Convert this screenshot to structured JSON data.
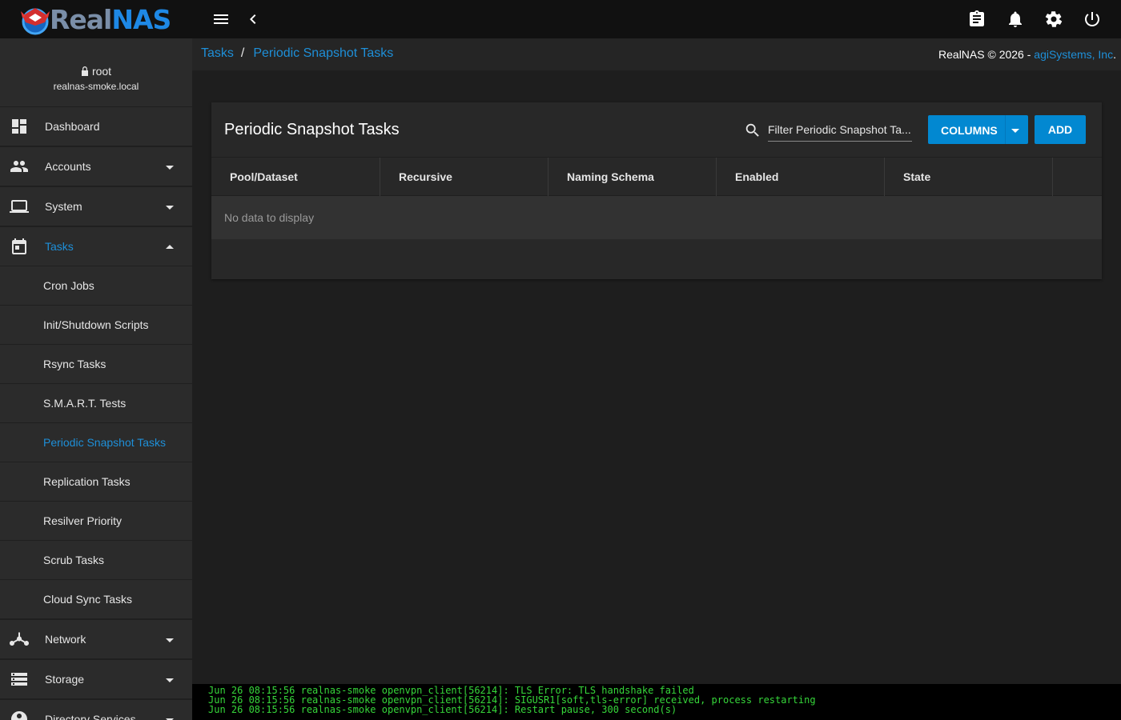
{
  "app": {
    "logo_real": "Real",
    "logo_nas": "NAS"
  },
  "topbar": {
    "icons": [
      "menu-icon",
      "chevron-left-icon",
      "clipboard-icon",
      "bell-icon",
      "gear-icon",
      "power-icon"
    ]
  },
  "user": {
    "name": "root",
    "host": "realnas-smoke.local"
  },
  "sidebar": {
    "items": [
      {
        "label": "Dashboard",
        "icon": "dashboard-icon",
        "expandable": false
      },
      {
        "label": "Accounts",
        "icon": "people-icon",
        "expandable": true,
        "expanded": false
      },
      {
        "label": "System",
        "icon": "laptop-icon",
        "expandable": true,
        "expanded": false
      },
      {
        "label": "Tasks",
        "icon": "calendar-icon",
        "expandable": true,
        "expanded": true,
        "active": true
      },
      {
        "label": "Network",
        "icon": "network-icon",
        "expandable": true,
        "expanded": false
      },
      {
        "label": "Storage",
        "icon": "storage-icon",
        "expandable": true,
        "expanded": false
      },
      {
        "label": "Directory Services",
        "icon": "directory-icon",
        "expandable": true,
        "expanded": false
      }
    ],
    "task_subitems": [
      "Cron Jobs",
      "Init/Shutdown Scripts",
      "Rsync Tasks",
      "S.M.A.R.T. Tests",
      "Periodic Snapshot Tasks",
      "Replication Tasks",
      "Resilver Priority",
      "Scrub Tasks",
      "Cloud Sync Tasks"
    ],
    "active_subitem": "Periodic Snapshot Tasks"
  },
  "breadcrumb": {
    "parent": "Tasks",
    "separator": "/",
    "current": "Periodic Snapshot Tasks"
  },
  "copyright": {
    "text": "RealNAS © 2026 - ",
    "company": "agiSystems, Inc",
    "suffix": "."
  },
  "card": {
    "title": "Periodic Snapshot Tasks",
    "filter_placeholder": "Filter Periodic Snapshot Ta...",
    "columns_button": "COLUMNS",
    "add_button": "ADD",
    "columns": [
      "Pool/Dataset",
      "Recursive",
      "Naming Schema",
      "Enabled",
      "State"
    ],
    "empty_message": "No data to display"
  },
  "console": {
    "lines": [
      "Jun 26 08:15:56 realnas-smoke openvpn_client[56214]: TLS Error: TLS handshake failed",
      "Jun 26 08:15:56 realnas-smoke openvpn_client[56214]: SIGUSR1[soft,tls-error] received, process restarting",
      "Jun 26 08:15:56 realnas-smoke openvpn_client[56214]: Restart pause, 300 second(s)"
    ]
  },
  "colors": {
    "accent": "#1e8fd8",
    "button": "#0288d1",
    "console_text": "#36d63a"
  }
}
